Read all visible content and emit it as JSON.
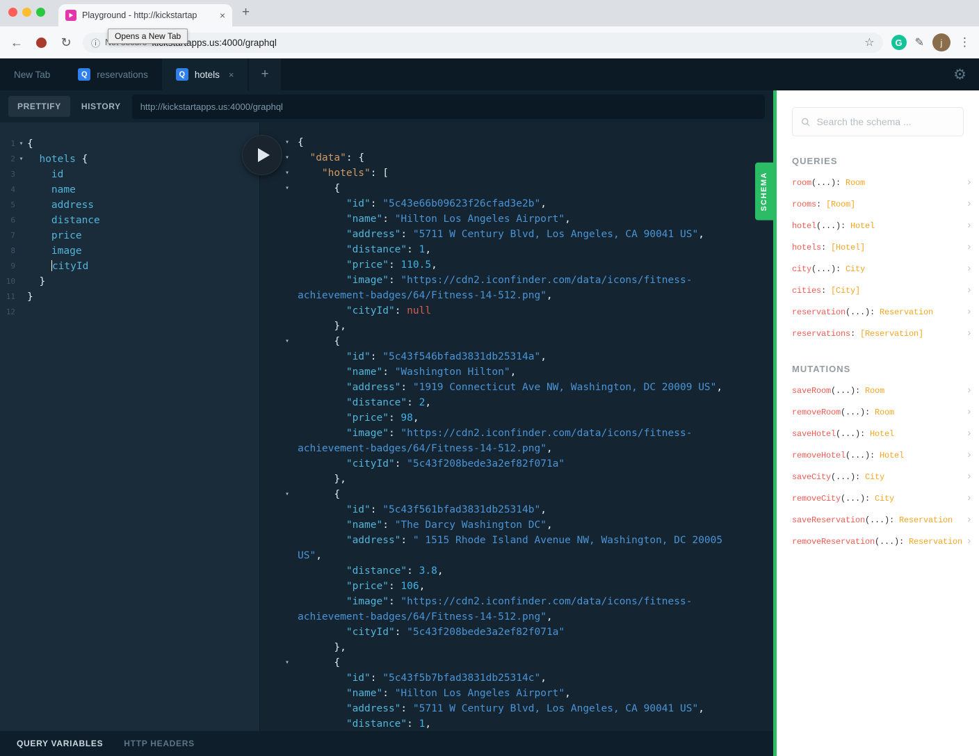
{
  "browser": {
    "tab": {
      "title": "Playground - http://kickstartap"
    },
    "toolbar": {
      "not_secure_label": "Not secure",
      "url": "kickstartapps.us:4000/graphql",
      "tooltip": "Opens a New Tab",
      "grammarly_letter": "G",
      "avatar_letter": "j"
    }
  },
  "icons": {
    "back_arrow": "←",
    "reload": "↻",
    "info": "ⓘ",
    "star": "☆",
    "menu_dots": "⋮",
    "pen": "✎",
    "close": "×",
    "tab_plus": "+",
    "gear": "⚙",
    "fold_caret": "▾",
    "chevron": "›"
  },
  "playground": {
    "tabbar": {
      "tabs": [
        {
          "label": "New Tab",
          "badge": "",
          "active": false
        },
        {
          "label": "reservations",
          "badge": "Q",
          "active": false
        },
        {
          "label": "hotels",
          "badge": "Q",
          "active": true
        }
      ]
    },
    "toolbar": {
      "prettify_label": "PRETTIFY",
      "history_label": "HISTORY",
      "endpoint_url": "http://kickstartapps.us:4000/graphql"
    },
    "schema_tab_label": "SCHEMA",
    "bottom_bar": {
      "query_variables_label": "QUERY VARIABLES",
      "http_headers_label": "HTTP HEADERS"
    }
  },
  "query_editor": {
    "lines": [
      {
        "num": 1,
        "fold": true,
        "segs": [
          [
            "w",
            "{"
          ]
        ]
      },
      {
        "num": 2,
        "fold": true,
        "segs": [
          [
            "w",
            "  "
          ],
          [
            "f",
            "hotels"
          ],
          [
            "w",
            " {"
          ]
        ]
      },
      {
        "num": 3,
        "segs": [
          [
            "w",
            "    "
          ],
          [
            "f",
            "id"
          ]
        ]
      },
      {
        "num": 4,
        "segs": [
          [
            "w",
            "    "
          ],
          [
            "f",
            "name"
          ]
        ]
      },
      {
        "num": 5,
        "segs": [
          [
            "w",
            "    "
          ],
          [
            "f",
            "address"
          ]
        ]
      },
      {
        "num": 6,
        "segs": [
          [
            "w",
            "    "
          ],
          [
            "f",
            "distance"
          ]
        ]
      },
      {
        "num": 7,
        "segs": [
          [
            "w",
            "    "
          ],
          [
            "f",
            "price"
          ]
        ]
      },
      {
        "num": 8,
        "segs": [
          [
            "w",
            "    "
          ],
          [
            "f",
            "image"
          ]
        ]
      },
      {
        "num": 9,
        "segs": [
          [
            "w",
            "    "
          ],
          [
            "cur",
            ""
          ],
          [
            "f",
            "cityId"
          ]
        ]
      },
      {
        "num": 10,
        "segs": [
          [
            "w",
            "  }"
          ]
        ]
      },
      {
        "num": 11,
        "segs": [
          [
            "w",
            "}"
          ]
        ]
      },
      {
        "num": 12,
        "segs": []
      }
    ]
  },
  "result_viewer": {
    "lines": [
      {
        "fold": true,
        "segs": [
          [
            "w",
            "{"
          ]
        ]
      },
      {
        "fold": true,
        "segs": [
          [
            "w",
            "  "
          ],
          [
            "K",
            "\"data\""
          ],
          [
            "w",
            ": {"
          ]
        ]
      },
      {
        "fold": true,
        "segs": [
          [
            "w",
            "    "
          ],
          [
            "K",
            "\"hotels\""
          ],
          [
            "w",
            ": ["
          ]
        ]
      },
      {
        "fold": true,
        "segs": [
          [
            "w",
            "      {"
          ]
        ]
      },
      {
        "segs": [
          [
            "w",
            "        "
          ],
          [
            "k",
            "\"id\""
          ],
          [
            "w",
            ": "
          ],
          [
            "s",
            "\"5c43e66b09623f26cfad3e2b\""
          ],
          [
            "w",
            ","
          ]
        ]
      },
      {
        "segs": [
          [
            "w",
            "        "
          ],
          [
            "k",
            "\"name\""
          ],
          [
            "w",
            ": "
          ],
          [
            "s",
            "\"Hilton Los Angeles Airport\""
          ],
          [
            "w",
            ","
          ]
        ]
      },
      {
        "segs": [
          [
            "w",
            "        "
          ],
          [
            "k",
            "\"address\""
          ],
          [
            "w",
            ": "
          ],
          [
            "s",
            "\"5711 W Century Blvd, Los Angeles, CA 90041 US\""
          ],
          [
            "w",
            ","
          ]
        ]
      },
      {
        "segs": [
          [
            "w",
            "        "
          ],
          [
            "k",
            "\"distance\""
          ],
          [
            "w",
            ": "
          ],
          [
            "n",
            "1"
          ],
          [
            "w",
            ","
          ]
        ]
      },
      {
        "segs": [
          [
            "w",
            "        "
          ],
          [
            "k",
            "\"price\""
          ],
          [
            "w",
            ": "
          ],
          [
            "n",
            "110.5"
          ],
          [
            "w",
            ","
          ]
        ]
      },
      {
        "segs": [
          [
            "w",
            "        "
          ],
          [
            "k",
            "\"image\""
          ],
          [
            "w",
            ": "
          ],
          [
            "s",
            "\"https://cdn2.iconfinder.com/data/icons/fitness-"
          ]
        ]
      },
      {
        "segs": [
          [
            "s",
            "achievement-badges/64/Fitness-14-512.png\""
          ],
          [
            "w",
            ","
          ]
        ]
      },
      {
        "segs": [
          [
            "w",
            "        "
          ],
          [
            "k",
            "\"cityId\""
          ],
          [
            "w",
            ": "
          ],
          [
            "u",
            "null"
          ]
        ]
      },
      {
        "segs": [
          [
            "w",
            "      },"
          ]
        ]
      },
      {
        "fold": true,
        "segs": [
          [
            "w",
            "      {"
          ]
        ]
      },
      {
        "segs": [
          [
            "w",
            "        "
          ],
          [
            "k",
            "\"id\""
          ],
          [
            "w",
            ": "
          ],
          [
            "s",
            "\"5c43f546bfad3831db25314a\""
          ],
          [
            "w",
            ","
          ]
        ]
      },
      {
        "segs": [
          [
            "w",
            "        "
          ],
          [
            "k",
            "\"name\""
          ],
          [
            "w",
            ": "
          ],
          [
            "s",
            "\"Washington Hilton\""
          ],
          [
            "w",
            ","
          ]
        ]
      },
      {
        "segs": [
          [
            "w",
            "        "
          ],
          [
            "k",
            "\"address\""
          ],
          [
            "w",
            ": "
          ],
          [
            "s",
            "\"1919 Connecticut Ave NW, Washington, DC 20009 US\""
          ],
          [
            "w",
            ","
          ]
        ]
      },
      {
        "segs": [
          [
            "w",
            "        "
          ],
          [
            "k",
            "\"distance\""
          ],
          [
            "w",
            ": "
          ],
          [
            "n",
            "2"
          ],
          [
            "w",
            ","
          ]
        ]
      },
      {
        "segs": [
          [
            "w",
            "        "
          ],
          [
            "k",
            "\"price\""
          ],
          [
            "w",
            ": "
          ],
          [
            "n",
            "98"
          ],
          [
            "w",
            ","
          ]
        ]
      },
      {
        "segs": [
          [
            "w",
            "        "
          ],
          [
            "k",
            "\"image\""
          ],
          [
            "w",
            ": "
          ],
          [
            "s",
            "\"https://cdn2.iconfinder.com/data/icons/fitness-"
          ]
        ]
      },
      {
        "segs": [
          [
            "s",
            "achievement-badges/64/Fitness-14-512.png\""
          ],
          [
            "w",
            ","
          ]
        ]
      },
      {
        "segs": [
          [
            "w",
            "        "
          ],
          [
            "k",
            "\"cityId\""
          ],
          [
            "w",
            ": "
          ],
          [
            "s",
            "\"5c43f208bede3a2ef82f071a\""
          ]
        ]
      },
      {
        "segs": [
          [
            "w",
            "      },"
          ]
        ]
      },
      {
        "fold": true,
        "segs": [
          [
            "w",
            "      {"
          ]
        ]
      },
      {
        "segs": [
          [
            "w",
            "        "
          ],
          [
            "k",
            "\"id\""
          ],
          [
            "w",
            ": "
          ],
          [
            "s",
            "\"5c43f561bfad3831db25314b\""
          ],
          [
            "w",
            ","
          ]
        ]
      },
      {
        "segs": [
          [
            "w",
            "        "
          ],
          [
            "k",
            "\"name\""
          ],
          [
            "w",
            ": "
          ],
          [
            "s",
            "\"The Darcy Washington DC\""
          ],
          [
            "w",
            ","
          ]
        ]
      },
      {
        "segs": [
          [
            "w",
            "        "
          ],
          [
            "k",
            "\"address\""
          ],
          [
            "w",
            ": "
          ],
          [
            "s",
            "\" 1515 Rhode Island Avenue NW, Washington, DC 20005"
          ]
        ]
      },
      {
        "segs": [
          [
            "s",
            "US\""
          ],
          [
            "w",
            ","
          ]
        ]
      },
      {
        "segs": [
          [
            "w",
            "        "
          ],
          [
            "k",
            "\"distance\""
          ],
          [
            "w",
            ": "
          ],
          [
            "n",
            "3.8"
          ],
          [
            "w",
            ","
          ]
        ]
      },
      {
        "segs": [
          [
            "w",
            "        "
          ],
          [
            "k",
            "\"price\""
          ],
          [
            "w",
            ": "
          ],
          [
            "n",
            "106"
          ],
          [
            "w",
            ","
          ]
        ]
      },
      {
        "segs": [
          [
            "w",
            "        "
          ],
          [
            "k",
            "\"image\""
          ],
          [
            "w",
            ": "
          ],
          [
            "s",
            "\"https://cdn2.iconfinder.com/data/icons/fitness-"
          ]
        ]
      },
      {
        "segs": [
          [
            "s",
            "achievement-badges/64/Fitness-14-512.png\""
          ],
          [
            "w",
            ","
          ]
        ]
      },
      {
        "segs": [
          [
            "w",
            "        "
          ],
          [
            "k",
            "\"cityId\""
          ],
          [
            "w",
            ": "
          ],
          [
            "s",
            "\"5c43f208bede3a2ef82f071a\""
          ]
        ]
      },
      {
        "segs": [
          [
            "w",
            "      },"
          ]
        ]
      },
      {
        "fold": true,
        "segs": [
          [
            "w",
            "      {"
          ]
        ]
      },
      {
        "segs": [
          [
            "w",
            "        "
          ],
          [
            "k",
            "\"id\""
          ],
          [
            "w",
            ": "
          ],
          [
            "s",
            "\"5c43f5b7bfad3831db25314c\""
          ],
          [
            "w",
            ","
          ]
        ]
      },
      {
        "segs": [
          [
            "w",
            "        "
          ],
          [
            "k",
            "\"name\""
          ],
          [
            "w",
            ": "
          ],
          [
            "s",
            "\"Hilton Los Angeles Airport\""
          ],
          [
            "w",
            ","
          ]
        ]
      },
      {
        "segs": [
          [
            "w",
            "        "
          ],
          [
            "k",
            "\"address\""
          ],
          [
            "w",
            ": "
          ],
          [
            "s",
            "\"5711 W Century Blvd, Los Angeles, CA 90041 US\""
          ],
          [
            "w",
            ","
          ]
        ]
      },
      {
        "segs": [
          [
            "w",
            "        "
          ],
          [
            "k",
            "\"distance\""
          ],
          [
            "w",
            ": "
          ],
          [
            "n",
            "1"
          ],
          [
            "w",
            ","
          ]
        ]
      }
    ]
  },
  "schema_sidebar": {
    "search_placeholder": "Search the schema ...",
    "sections": [
      {
        "title": "QUERIES",
        "fields": [
          {
            "name": "room",
            "args": "(...)",
            "type": "Room"
          },
          {
            "name": "rooms",
            "args": "",
            "type": "[Room]"
          },
          {
            "name": "hotel",
            "args": "(...)",
            "type": "Hotel"
          },
          {
            "name": "hotels",
            "args": "",
            "type": "[Hotel]"
          },
          {
            "name": "city",
            "args": "(...)",
            "type": "City"
          },
          {
            "name": "cities",
            "args": "",
            "type": "[City]"
          },
          {
            "name": "reservation",
            "args": "(...)",
            "type": "Reservation"
          },
          {
            "name": "reservations",
            "args": "",
            "type": "[Reservation]"
          }
        ]
      },
      {
        "title": "MUTATIONS",
        "fields": [
          {
            "name": "saveRoom",
            "args": "(...)",
            "type": "Room"
          },
          {
            "name": "removeRoom",
            "args": "(...)",
            "type": "Room"
          },
          {
            "name": "saveHotel",
            "args": "(...)",
            "type": "Hotel"
          },
          {
            "name": "removeHotel",
            "args": "(...)",
            "type": "Hotel"
          },
          {
            "name": "saveCity",
            "args": "(...)",
            "type": "City"
          },
          {
            "name": "removeCity",
            "args": "(...)",
            "type": "City"
          },
          {
            "name": "saveReservation",
            "args": "(...)",
            "type": "Reservation"
          },
          {
            "name": "removeReservation",
            "args": "(...)",
            "type": "Reservation"
          }
        ]
      }
    ]
  },
  "colors": {
    "green": "#2dbc66",
    "badge_blue": "#2f80ed",
    "field_red": "#f25c54",
    "type_orange": "#f5a623",
    "tok_w": "#e3ecf2",
    "tok_f": "#53b4d9",
    "tok_k": "#53b4d9",
    "tok_K": "#d19a66",
    "tok_s": "#4a94d6",
    "tok_n": "#3fb2e5",
    "tok_u": "#d95c4a"
  }
}
